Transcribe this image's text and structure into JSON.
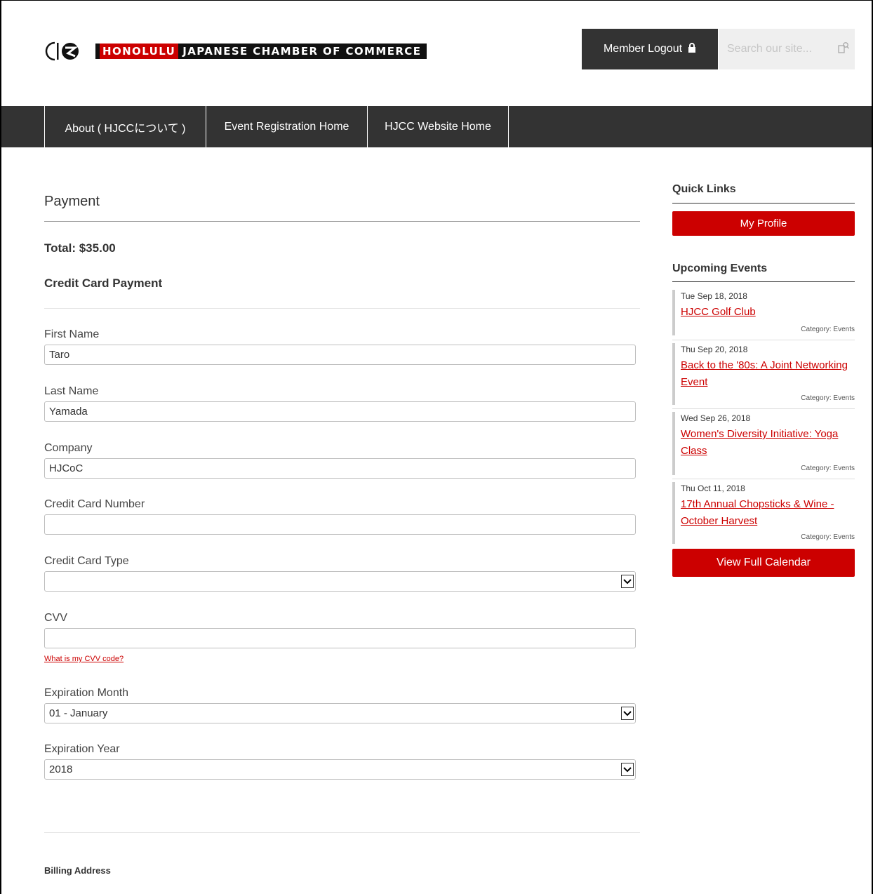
{
  "header": {
    "logo_highlight": "HONOLULU",
    "logo_text": "JAPANESE CHAMBER OF COMMERCE",
    "member_label": "Member Logout",
    "search_placeholder": "Search our site...",
    "icons": {
      "lock": "lock-icon",
      "search": "search-icon"
    }
  },
  "nav": {
    "items": [
      {
        "label": "About ( HJCCについて )"
      },
      {
        "label": "Event Registration Home"
      },
      {
        "label": "HJCC Website Home"
      }
    ]
  },
  "main": {
    "title": "Payment",
    "total": "Total: $35.00",
    "cc_heading": "Credit Card Payment",
    "fields": {
      "first_name": {
        "label": "First Name",
        "value": "Taro"
      },
      "last_name": {
        "label": "Last Name",
        "value": "Yamada"
      },
      "company": {
        "label": "Company",
        "value": "HJCoC"
      },
      "cc_number": {
        "label": "Credit Card Number",
        "value": ""
      },
      "cc_type": {
        "label": "Credit Card Type",
        "value": ""
      },
      "cvv": {
        "label": "CVV",
        "value": ""
      },
      "exp_month": {
        "label": "Expiration Month",
        "value": "01 - January"
      },
      "exp_year": {
        "label": "Expiration Year",
        "value": "2018"
      }
    },
    "cvv_link": "What is my CVV code?",
    "billing_heading": "Billing Address"
  },
  "sidebar": {
    "quick_links_title": "Quick Links",
    "my_profile": "My Profile",
    "upcoming_title": "Upcoming Events",
    "events": [
      {
        "date": "Tue Sep 18, 2018",
        "title": "HJCC Golf Club",
        "category": "Category: Events"
      },
      {
        "date": "Thu Sep 20, 2018",
        "title": "Back to the '80s: A Joint Networking Event",
        "category": "Category: Events"
      },
      {
        "date": "Wed Sep 26, 2018",
        "title": "Women's Diversity Initiative: Yoga Class",
        "category": "Category: Events"
      },
      {
        "date": "Thu Oct 11, 2018",
        "title": "17th Annual Chopsticks & Wine - October Harvest",
        "category": "Category: Events"
      }
    ],
    "calendar_button": "View Full Calendar"
  },
  "colors": {
    "accent": "#cc0000",
    "dark": "#333333"
  }
}
